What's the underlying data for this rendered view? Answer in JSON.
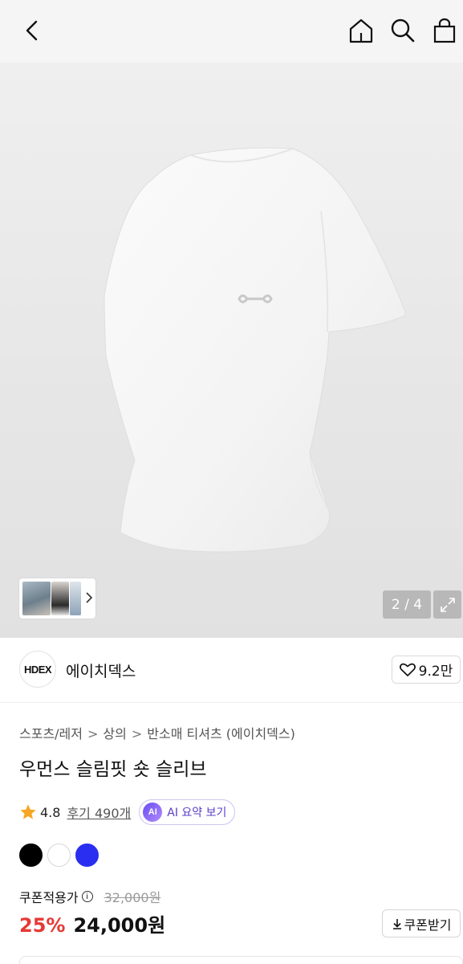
{
  "header": {
    "back_icon": "chevron-left-icon",
    "home_icon": "home-icon",
    "search_icon": "search-icon",
    "bag_icon": "shopping-bag-icon"
  },
  "gallery": {
    "counter": "2 / 4",
    "expand_icon": "expand-icon",
    "thumb_next_icon": "chevron-right-icon"
  },
  "brand": {
    "logo_text": "HDEX",
    "name": "에이치덱스",
    "likes": "9.2만",
    "like_icon": "heart-icon"
  },
  "product": {
    "breadcrumb": [
      "스포츠/레저",
      "상의",
      "반소매 티셔츠 (에이치덱스)"
    ],
    "breadcrumb_sep": ">",
    "title": "우먼스 슬림핏 숏 슬리브",
    "rating": "4.8",
    "reviews": "후기 490개",
    "ai_badge": "AI",
    "ai_label": "AI 요약 보기",
    "star_color": "#f5a623"
  },
  "colors": [
    "#000000",
    "#ffffff",
    "#2a2ef0"
  ],
  "pricing": {
    "coupon_label": "쿠폰적용가",
    "info_icon_text": "i",
    "original_price": "32,000원",
    "discount": "25%",
    "price": "24,000원",
    "coupon_button": "쿠폰받기",
    "discount_color": "#e53935"
  }
}
